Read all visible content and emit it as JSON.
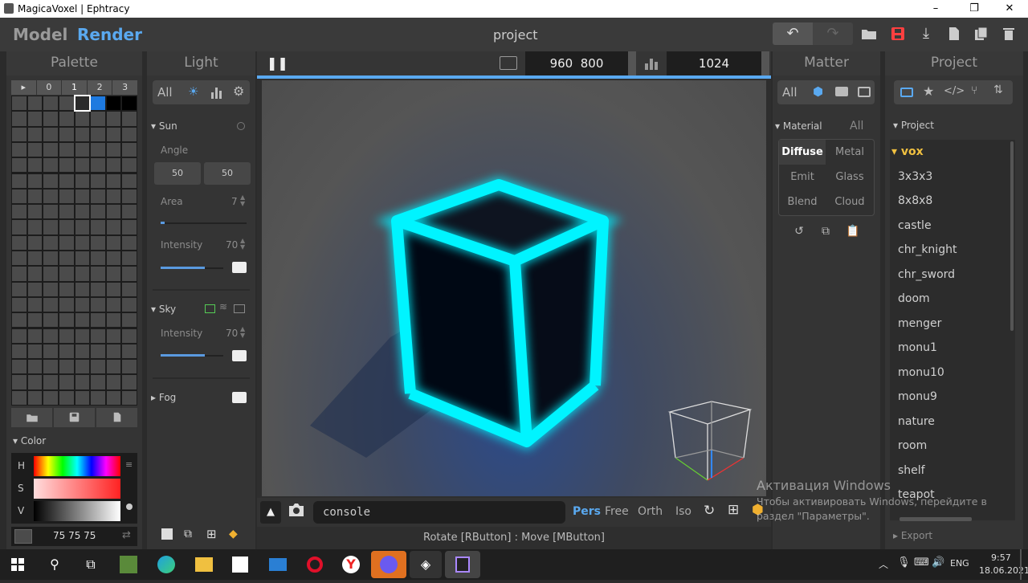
{
  "window": {
    "title": "MagicaVoxel | Ephtracy",
    "minimize": "–",
    "maximize": "❐",
    "close": "✕"
  },
  "topbar": {
    "model_tab": "Model",
    "render_tab": "Render",
    "project_name": "project"
  },
  "palette": {
    "title": "Palette",
    "pages": [
      "▸",
      "0",
      "1",
      "2",
      "3"
    ],
    "color_section": "Color",
    "hsv": {
      "h": "H",
      "s": "S",
      "v": "V"
    },
    "rgb_value": "75  75  75"
  },
  "light": {
    "title": "Light",
    "filter_all": "All",
    "sun": {
      "label": "Sun",
      "angle_label": "Angle",
      "angle_1": "50",
      "angle_2": "50",
      "area_label": "Area",
      "area_value": "7",
      "area_fraction": 0.05,
      "intensity_label": "Intensity",
      "intensity_value": "70",
      "intensity_fraction": 0.7
    },
    "sky": {
      "label": "Sky",
      "intensity_label": "Intensity",
      "intensity_value": "70",
      "intensity_fraction": 0.7
    },
    "fog": {
      "label": "Fog"
    }
  },
  "viewport": {
    "res_w": "960",
    "res_h": "800",
    "samples": "1024",
    "console_text": "console",
    "views": [
      "Pers",
      "Free",
      "Orth",
      "Iso"
    ],
    "status": "Rotate [RButton] : Move [MButton]"
  },
  "matter": {
    "title": "Matter",
    "filter_all": "All",
    "material_label": "Material",
    "material_all": "All",
    "materials": [
      "Diffuse",
      "Metal",
      "Emit",
      "Glass",
      "Blend",
      "Cloud"
    ]
  },
  "project": {
    "title": "Project",
    "section": "Project",
    "folder": "vox",
    "items": [
      "3x3x3",
      "8x8x8",
      "castle",
      "chr_knight",
      "chr_sword",
      "doom",
      "menger",
      "monu1",
      "monu10",
      "monu9",
      "nature",
      "room",
      "shelf",
      "teapot"
    ],
    "export_label": "Export"
  },
  "activation": {
    "title": "Активация Windows",
    "body": "Чтобы активировать Windows, перейдите в раздел \"Параметры\"."
  },
  "taskbar": {
    "lang": "ENG",
    "time": "9:57",
    "date": "18.06.2021"
  },
  "colors": {
    "accent": "#5aa9f0",
    "cube_glow": "#00f0ff",
    "bg": "#2b2b2b"
  }
}
